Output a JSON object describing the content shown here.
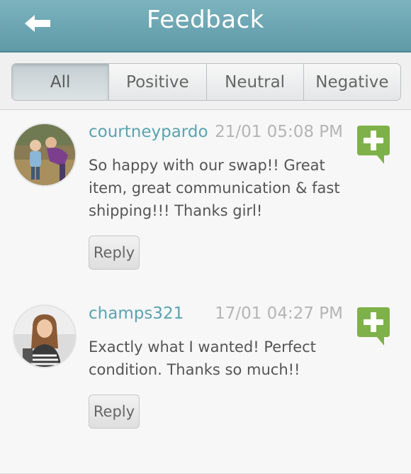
{
  "header": {
    "title": "Feedback",
    "back_icon": "back-arrow-icon"
  },
  "filters": {
    "tabs": [
      {
        "label": "All",
        "active": true
      },
      {
        "label": "Positive",
        "active": false
      },
      {
        "label": "Neutral",
        "active": false
      },
      {
        "label": "Negative",
        "active": false
      }
    ]
  },
  "feedback": [
    {
      "username": "courtneypardo",
      "date": "21/01 05:08 PM",
      "message": "So happy with our swap!! Great item, great communication & fast shipping!!! Thanks girl!",
      "reply_label": "Reply",
      "rating": "positive",
      "rating_icon": "positive-plus-icon"
    },
    {
      "username": "champs321",
      "date": "17/01 04:27 PM",
      "message": "Exactly what I wanted! Perfect condition. Thanks so much!!",
      "reply_label": "Reply",
      "rating": "positive",
      "rating_icon": "positive-plus-icon"
    }
  ],
  "colors": {
    "header": "#6aa7b3",
    "username": "#5aa3b1",
    "positive_badge": "#7fb14a"
  }
}
